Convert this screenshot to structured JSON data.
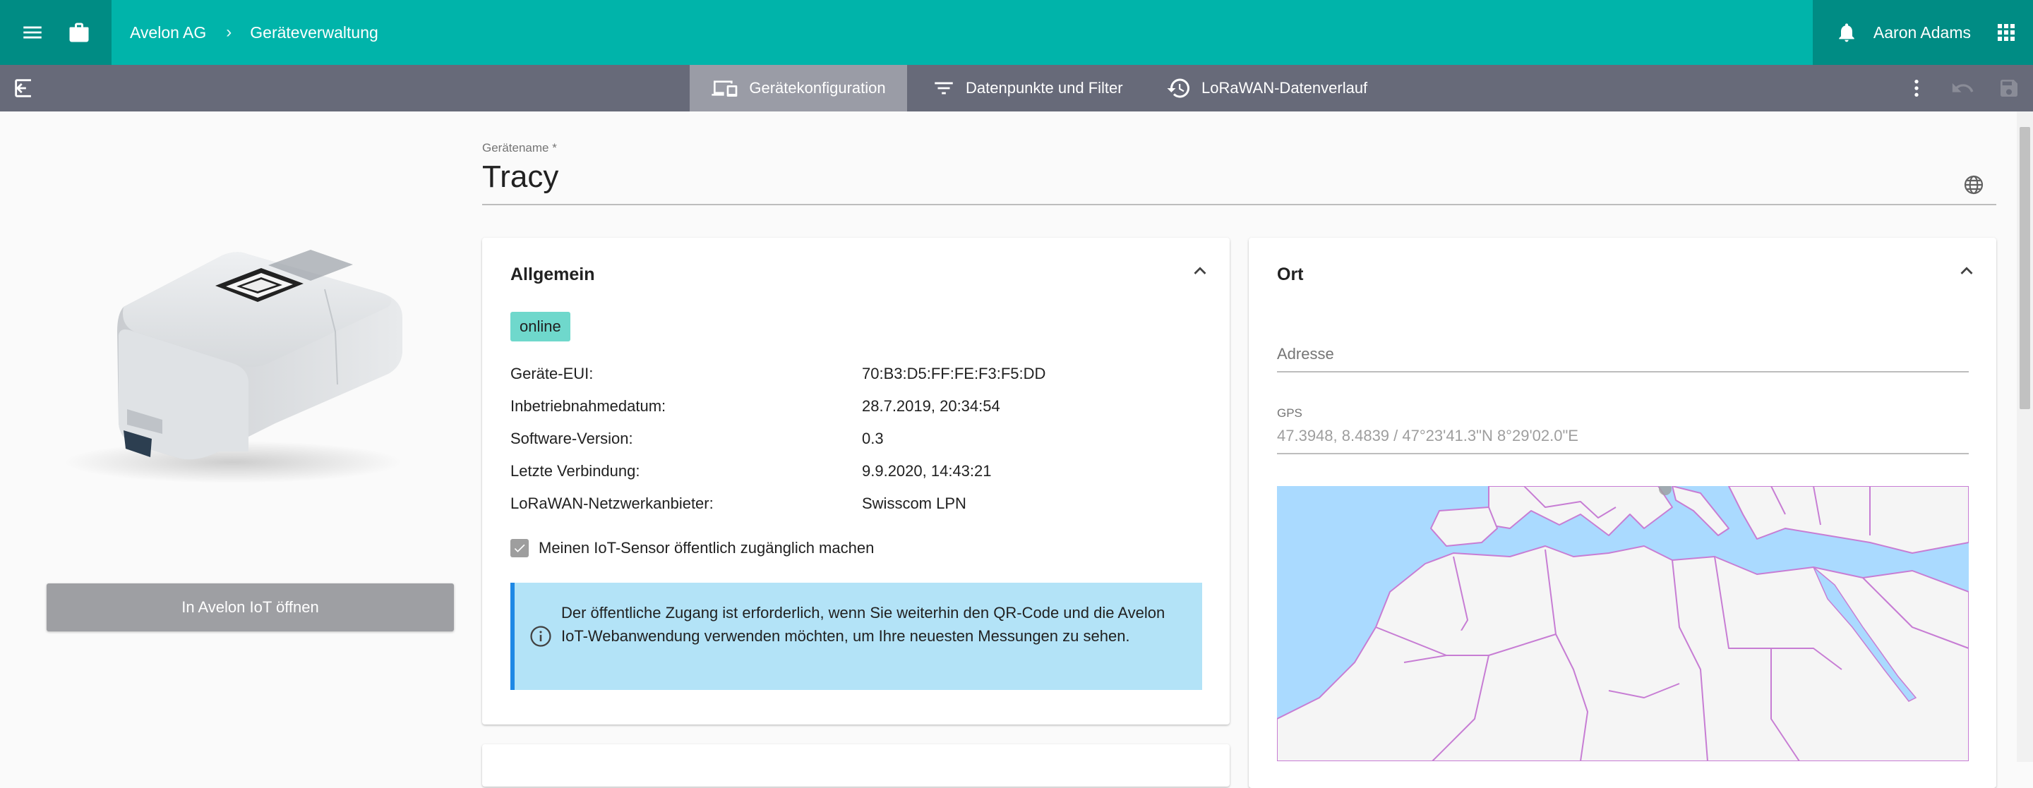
{
  "appbar": {
    "breadcrumb": [
      {
        "label": "Avelon AG"
      },
      {
        "separator": "›"
      },
      {
        "label": "Geräteverwaltung"
      }
    ],
    "user_name": "Aaron Adams"
  },
  "toolbar": {
    "tabs": [
      {
        "label": "Gerätekonfiguration",
        "active": true
      },
      {
        "label": "Datenpunkte und Filter",
        "active": false
      },
      {
        "label": "LoRaWAN-Datenverlauf",
        "active": false
      }
    ]
  },
  "left": {
    "open_button_label": "In Avelon IoT öffnen"
  },
  "device_name": {
    "label": "Gerätename *",
    "value": "Tracy"
  },
  "general_card": {
    "title": "Allgemein",
    "status_badge": "online",
    "rows": [
      {
        "key": "Geräte-EUI:",
        "value": "70:B3:D5:FF:FE:F3:F5:DD"
      },
      {
        "key": "Inbetriebnahmedatum:",
        "value": "28.7.2019, 20:34:54"
      },
      {
        "key": "Software-Version:",
        "value": "0.3"
      },
      {
        "key": "Letzte Verbindung:",
        "value": "9.9.2020, 14:43:21"
      },
      {
        "key": "LoRaWAN-Netzwerkanbieter:",
        "value": "Swisscom LPN"
      }
    ],
    "public_checkbox_label": "Meinen IoT-Sensor öffentlich zugänglich machen",
    "public_checkbox_checked": true,
    "info_text": "Der öffentliche Zugang ist erforderlich, wenn Sie weiterhin den QR-Code und die Avelon IoT-Webanwendung verwenden möchten, um Ihre neuesten Messungen zu sehen."
  },
  "location_card": {
    "title": "Ort",
    "address_placeholder": "Adresse",
    "gps_label": "GPS",
    "gps_value": "47.3948, 8.4839  /  47°23'41.3\"N 8°29'02.0\"E"
  },
  "colors": {
    "appbar": "#00b4aa",
    "appbar_dark": "#008c84",
    "toolbar": "#676a79",
    "toolbar_active": "#9a9ca6",
    "badge_online": "#6fd8cc",
    "info_bg": "#b3e3f7",
    "info_border": "#1e88e5",
    "map_water": "#aadaff",
    "map_land": "#f5f5f5",
    "map_borders": "#c77dd4"
  },
  "icons": {
    "appbar": [
      "menu-icon",
      "briefcase-icon",
      "bell-icon",
      "apps-grid-icon"
    ],
    "toolbar": [
      "exit-icon",
      "devices-icon",
      "filter-icon",
      "history-icon",
      "more-vert-icon",
      "undo-icon",
      "save-icon"
    ],
    "content": [
      "globe-icon",
      "chevron-up-icon",
      "info-icon",
      "check-icon"
    ]
  }
}
